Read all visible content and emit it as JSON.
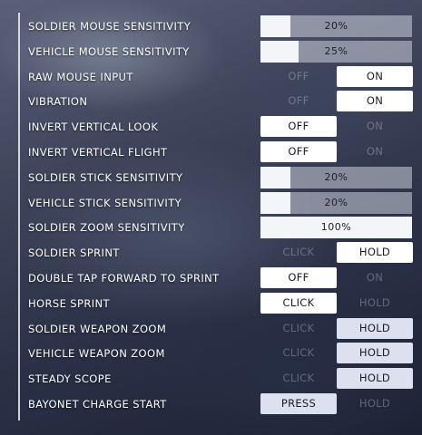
{
  "settings": [
    {
      "label": "SOLDIER MOUSE SENSITIVITY",
      "type": "slider",
      "value": "20%",
      "fraction": 0.2
    },
    {
      "label": "VEHICLE MOUSE SENSITIVITY",
      "type": "slider",
      "value": "25%",
      "fraction": 0.25
    },
    {
      "label": "RAW MOUSE INPUT",
      "type": "toggle",
      "options": [
        "OFF",
        "ON"
      ],
      "selected": 1
    },
    {
      "label": "VIBRATION",
      "type": "toggle",
      "options": [
        "OFF",
        "ON"
      ],
      "selected": 1
    },
    {
      "label": "INVERT VERTICAL LOOK",
      "type": "toggle",
      "options": [
        "OFF",
        "ON"
      ],
      "selected": 0
    },
    {
      "label": "INVERT VERTICAL FLIGHT",
      "type": "toggle",
      "options": [
        "OFF",
        "ON"
      ],
      "selected": 0
    },
    {
      "label": "SOLDIER STICK SENSITIVITY",
      "type": "slider",
      "value": "20%",
      "fraction": 0.2
    },
    {
      "label": "VEHICLE STICK SENSITIVITY",
      "type": "slider",
      "value": "20%",
      "fraction": 0.2
    },
    {
      "label": "SOLDIER ZOOM SENSITIVITY",
      "type": "slider",
      "value": "100%",
      "fraction": 1.0
    },
    {
      "label": "SOLDIER SPRINT",
      "type": "toggle",
      "options": [
        "CLICK",
        "HOLD"
      ],
      "selected": 1
    },
    {
      "label": "DOUBLE TAP FORWARD TO SPRINT",
      "type": "toggle",
      "options": [
        "OFF",
        "ON"
      ],
      "selected": 0
    },
    {
      "label": "HORSE SPRINT",
      "type": "toggle",
      "options": [
        "CLICK",
        "HOLD"
      ],
      "selected": 0
    },
    {
      "label": "SOLDIER WEAPON ZOOM",
      "type": "toggle",
      "options": [
        "CLICK",
        "HOLD"
      ],
      "selected": 1,
      "style": "lavender"
    },
    {
      "label": "VEHICLE WEAPON ZOOM",
      "type": "toggle",
      "options": [
        "CLICK",
        "HOLD"
      ],
      "selected": 1,
      "style": "lavender"
    },
    {
      "label": "STEADY SCOPE",
      "type": "toggle",
      "options": [
        "CLICK",
        "HOLD"
      ],
      "selected": 1,
      "style": "lavender"
    },
    {
      "label": "BAYONET CHARGE START",
      "type": "toggle",
      "options": [
        "PRESS",
        "HOLD"
      ],
      "selected": 0,
      "style": "lavender"
    }
  ]
}
